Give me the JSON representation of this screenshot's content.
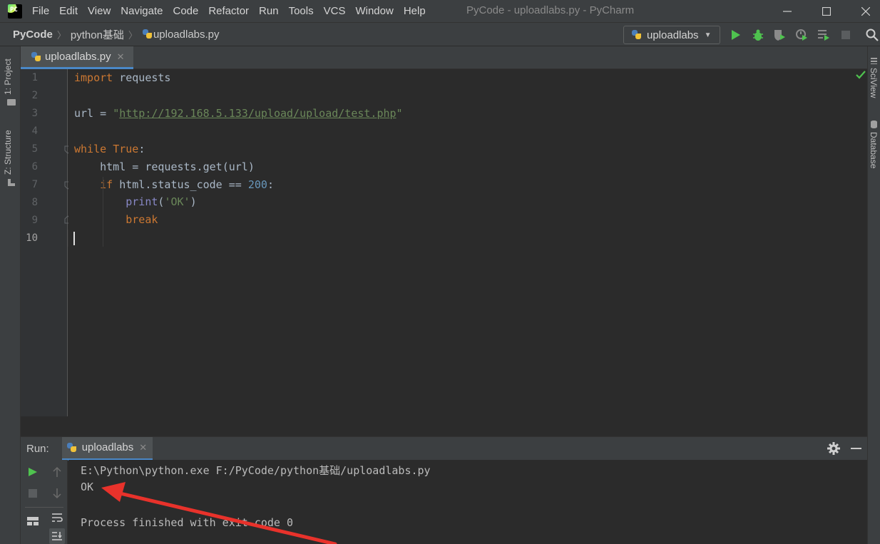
{
  "app": {
    "logo_text": "PC",
    "menus": [
      "File",
      "Edit",
      "View",
      "Navigate",
      "Code",
      "Refactor",
      "Run",
      "Tools",
      "VCS",
      "Window",
      "Help"
    ],
    "window_title": "PyCode - uploadlabs.py - PyCharm"
  },
  "nav": {
    "breadcrumbs": [
      "PyCode",
      "python基础",
      "uploadlabs.py"
    ],
    "run_config": "uploadlabs"
  },
  "side_tabs": {
    "left": [
      "1: Project",
      "Z: Structure"
    ],
    "right": [
      "SciView",
      "Database"
    ]
  },
  "editor": {
    "tab_label": "uploadlabs.py",
    "line_numbers": [
      "1",
      "2",
      "3",
      "4",
      "5",
      "6",
      "7",
      "8",
      "9",
      "10"
    ],
    "code": {
      "l1_kw": "import",
      "l1_rest": " requests",
      "l3_a": "url = ",
      "l3_q1": "\"",
      "l3_url": "http://192.168.5.133/upload/upload/test.php",
      "l3_q2": "\"",
      "l5_kw": "while",
      "l5_sp": " ",
      "l5_true": "True",
      "l5_colon": ":",
      "l6": "    html = requests.get(url)",
      "l7_ind": "    ",
      "l7_kw": "if",
      "l7_mid": " html.status_code == ",
      "l7_num": "200",
      "l7_colon": ":",
      "l8_ind": "        ",
      "l8_fn": "print",
      "l8_p1": "(",
      "l8_str": "'OK'",
      "l8_p2": ")",
      "l9_ind": "        ",
      "l9_kw": "break"
    }
  },
  "run": {
    "label": "Run:",
    "tab_label": "uploadlabs",
    "output": [
      "E:\\Python\\python.exe F:/PyCode/python基础/uploadlabs.py",
      "OK",
      "",
      "Process finished with exit code 0"
    ]
  },
  "colors": {
    "accent": "#4a88c7",
    "keyword": "#cc7832",
    "string": "#6a8759",
    "number": "#6897bb",
    "arrow": "#e8322b"
  }
}
